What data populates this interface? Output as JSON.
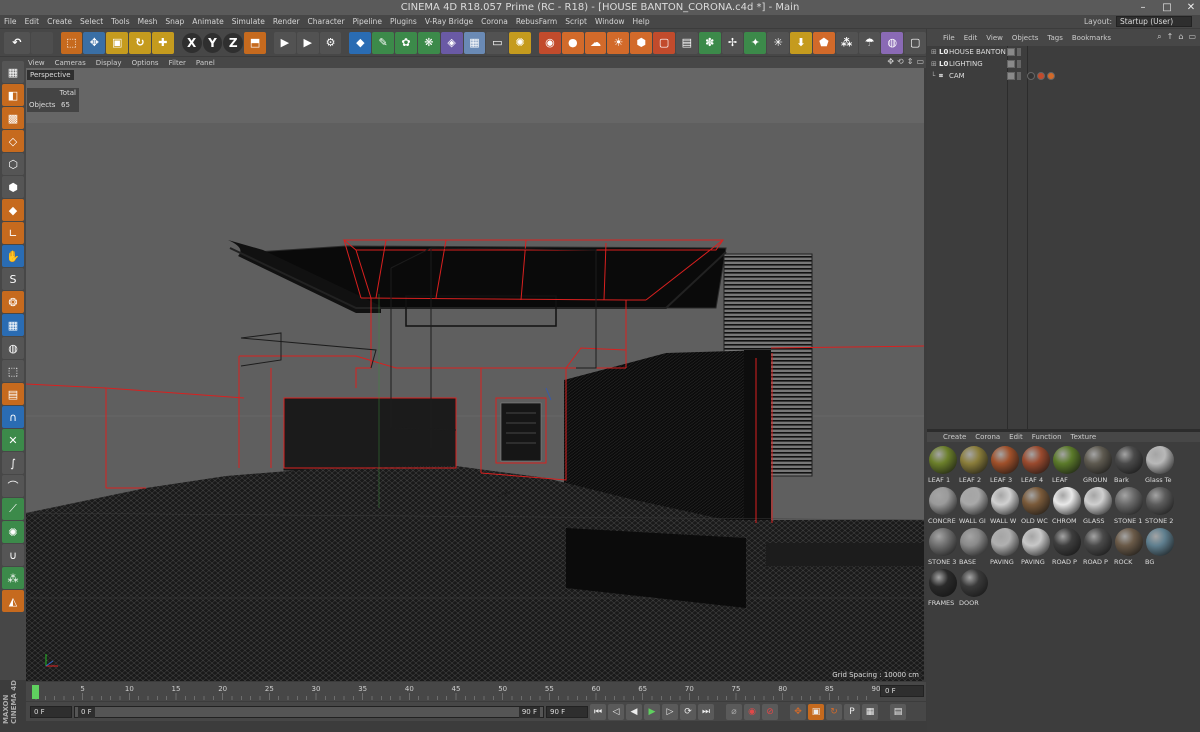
{
  "window": {
    "title": "CINEMA 4D R18.057 Prime (RC - R18) - [HOUSE BANTON_CORONA.c4d *] - Main",
    "controls": [
      "–",
      "□",
      "✕"
    ]
  },
  "menubar": {
    "items": [
      "File",
      "Edit",
      "Create",
      "Select",
      "Tools",
      "Mesh",
      "Snap",
      "Animate",
      "Simulate",
      "Render",
      "Character",
      "Pipeline",
      "Plugins",
      "V-Ray Bridge",
      "Corona",
      "RebusFarm",
      "Script",
      "Window",
      "Help"
    ],
    "layout_label": "Layout:",
    "layout_value": "Startup (User)"
  },
  "toolbar": {
    "axis_buttons": [
      "X",
      "Y",
      "Z"
    ]
  },
  "viewport": {
    "menu": [
      "View",
      "Cameras",
      "Display",
      "Options",
      "Filter",
      "Panel"
    ],
    "name": "Perspective",
    "hud_header": "Total",
    "hud_objects_label": "Objects",
    "hud_objects_value": "65",
    "grid_spacing": "Grid Spacing : 10000 cm"
  },
  "object_manager": {
    "menu": [
      "File",
      "Edit",
      "View",
      "Objects",
      "Tags",
      "Bookmarks"
    ],
    "objects": [
      {
        "name": "HOUSE BANTON",
        "icon": "L0"
      },
      {
        "name": "LIGHTING",
        "icon": "L0"
      },
      {
        "name": "CAM",
        "icon": "cam"
      }
    ]
  },
  "material_manager": {
    "menu": [
      "Create",
      "Corona",
      "Edit",
      "Function",
      "Texture"
    ],
    "materials": [
      {
        "name": "LEAF 1",
        "color": "#6b7f2a"
      },
      {
        "name": "LEAF 2",
        "color": "#8a7d3a"
      },
      {
        "name": "LEAF 3",
        "color": "#a0502a"
      },
      {
        "name": "LEAF 4",
        "color": "#9a4a2e"
      },
      {
        "name": "LEAF",
        "color": "#5b7a2a"
      },
      {
        "name": "GROUN",
        "color": "#5e5a50"
      },
      {
        "name": "Bark",
        "color": "#4a4a4a"
      },
      {
        "name": "Glass Te",
        "color": "#b8b8b8"
      },
      {
        "name": "CONCRE",
        "color": "#9a9a9a"
      },
      {
        "name": "WALL GI",
        "color": "#a8a8a8"
      },
      {
        "name": "WALL W",
        "color": "#d0d0d0"
      },
      {
        "name": "OLD WC",
        "color": "#7a5a3a"
      },
      {
        "name": "CHROM",
        "color": "#e8e8e8"
      },
      {
        "name": "GLASS",
        "color": "#cfcfcf"
      },
      {
        "name": "STONE 1",
        "color": "#6a6a6a"
      },
      {
        "name": "STONE 2",
        "color": "#5c5c5c"
      },
      {
        "name": "STONE 3",
        "color": "#707070"
      },
      {
        "name": "BASE",
        "color": "#8a8a8a"
      },
      {
        "name": "PAVING",
        "color": "#b0b0b0"
      },
      {
        "name": "PAVING",
        "color": "#c8c8c8"
      },
      {
        "name": "ROAD P",
        "color": "#3e3e3e"
      },
      {
        "name": "ROAD P",
        "color": "#4a4a4a"
      },
      {
        "name": "ROCK",
        "color": "#6a5a48"
      },
      {
        "name": "BG",
        "color": "#5f7f8f"
      },
      {
        "name": "FRAMES",
        "color": "#2a2a2a"
      },
      {
        "name": "DOOR",
        "color": "#3a3a3a"
      }
    ]
  },
  "timeline": {
    "ticks": [
      "0",
      "5",
      "10",
      "15",
      "20",
      "25",
      "30",
      "35",
      "40",
      "45",
      "50",
      "55",
      "60",
      "65",
      "70",
      "75",
      "80",
      "85",
      "90"
    ],
    "current_frame": "0 F"
  },
  "transport": {
    "start_field": "0 F",
    "range_start": "0 F",
    "range_end": "90 F",
    "end_field": "90 F"
  },
  "branding": {
    "logo": "MAXON CINEMA 4D"
  }
}
